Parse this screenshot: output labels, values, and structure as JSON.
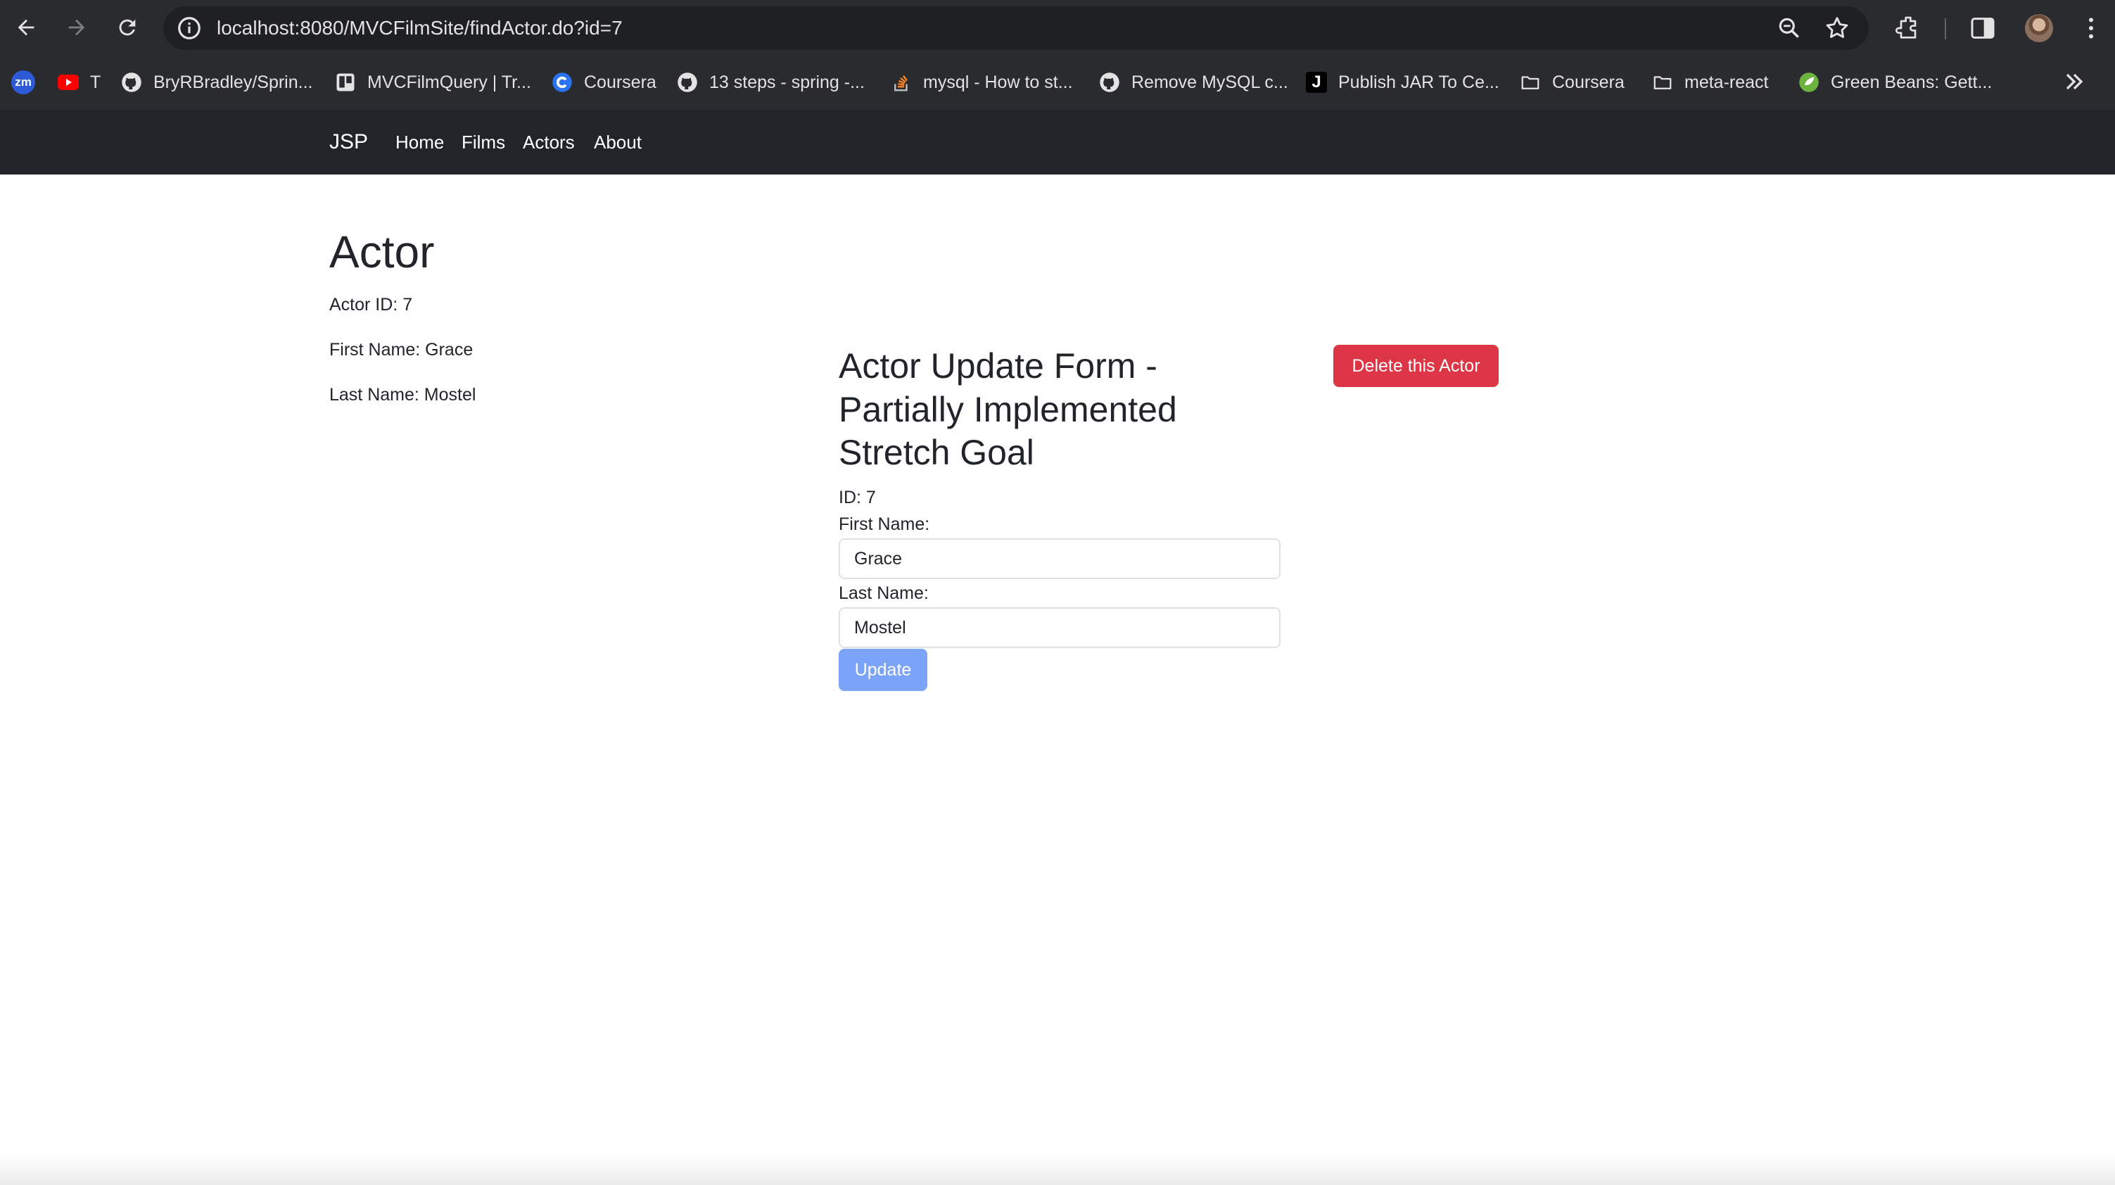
{
  "browser": {
    "url_host": "localhost",
    "url_rest": ":8080/MVCFilmSite/findActor.do?id=7",
    "bookmarks": [
      {
        "label": "",
        "icon": "zoom-icon"
      },
      {
        "label": "T",
        "icon": "youtube-icon"
      },
      {
        "label": "BryRBradley/Sprin...",
        "icon": "github-icon"
      },
      {
        "label": "MVCFilmQuery | Tr...",
        "icon": "trello-icon"
      },
      {
        "label": "Coursera",
        "icon": "coursera-icon"
      },
      {
        "label": "13 steps - spring -...",
        "icon": "github-icon"
      },
      {
        "label": "mysql - How to st...",
        "icon": "stackoverflow-icon"
      },
      {
        "label": "Remove MySQL c...",
        "icon": "github-icon"
      },
      {
        "label": "Publish JAR To Ce...",
        "icon": "j-icon"
      },
      {
        "label": "Coursera",
        "icon": "folder-icon"
      },
      {
        "label": "meta-react",
        "icon": "folder-icon"
      },
      {
        "label": "Green Beans: Gett...",
        "icon": "spring-icon"
      }
    ],
    "zoom_badge": "zm"
  },
  "navbar": {
    "brand": "JSP",
    "links": [
      "Home",
      "Films",
      "Actors",
      "About"
    ]
  },
  "actor": {
    "heading": "Actor",
    "id_label": "Actor ID:",
    "id_value": "7",
    "first_label": "First Name:",
    "first_value": "Grace",
    "last_label": "Last Name:",
    "last_value": "Mostel"
  },
  "update_form": {
    "title": "Actor Update Form - Partially Implemented Stretch Goal",
    "id_label": "ID:",
    "id_value": "7",
    "first_label": "First Name:",
    "first_value": "Grace",
    "last_label": "Last Name:",
    "last_value": "Mostel",
    "submit_label": "Update"
  },
  "delete_button_label": "Delete this Actor",
  "colors": {
    "navbar": "#212529",
    "update_button": "#7ba4f8",
    "delete_button": "#dc3545",
    "chrome": "#2a2b2e"
  }
}
